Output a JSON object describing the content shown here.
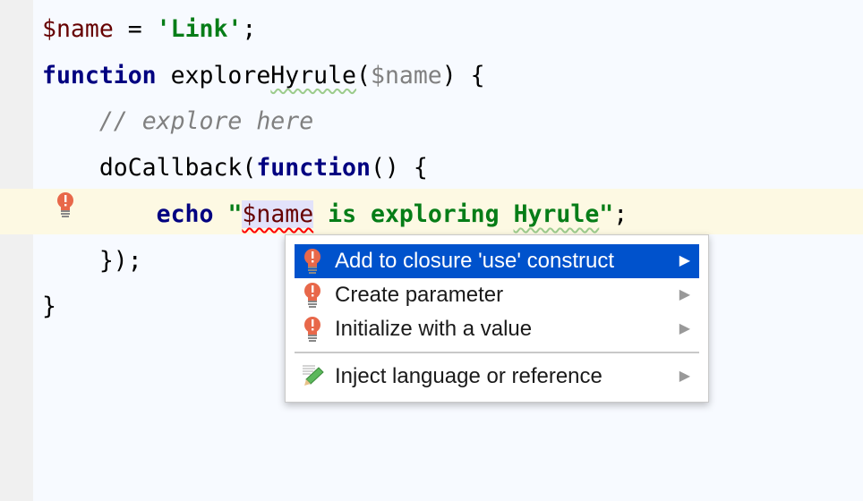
{
  "editor": {
    "lines": [
      [
        {
          "t": "$name",
          "c": "var"
        },
        {
          "t": " = ",
          "c": ""
        },
        {
          "t": "'Link'",
          "c": "str"
        },
        {
          "t": ";",
          "c": ""
        }
      ],
      [
        {
          "t": "function",
          "c": "kw"
        },
        {
          "t": " explore",
          "c": ""
        },
        {
          "t": "Hyrule",
          "c": "warn"
        },
        {
          "t": "(",
          "c": ""
        },
        {
          "t": "$name",
          "c": "param"
        },
        {
          "t": ") {",
          "c": ""
        }
      ],
      [
        {
          "t": "    ",
          "c": ""
        },
        {
          "t": "// explore here",
          "c": "cmt"
        }
      ],
      [
        {
          "t": "    doCallback(",
          "c": ""
        },
        {
          "t": "function",
          "c": "kw"
        },
        {
          "t": "() {",
          "c": ""
        }
      ],
      [
        {
          "t": "        ",
          "c": ""
        },
        {
          "t": "echo",
          "c": "kw"
        },
        {
          "t": " ",
          "c": ""
        },
        {
          "t": "\"",
          "c": "str"
        },
        {
          "t": "$name",
          "c": "var sel err"
        },
        {
          "t": " is exploring ",
          "c": "str"
        },
        {
          "t": "Hyrule",
          "c": "str warn"
        },
        {
          "t": "\"",
          "c": "str"
        },
        {
          "t": ";",
          "c": ""
        }
      ],
      [
        {
          "t": "    });",
          "c": ""
        }
      ],
      [
        {
          "t": "}",
          "c": ""
        }
      ]
    ]
  },
  "intention_menu": {
    "items": [
      {
        "label": "Add to closure 'use' construct",
        "icon": "error-bulb-icon",
        "active": true
      },
      {
        "label": "Create parameter",
        "icon": "error-bulb-icon",
        "active": false
      },
      {
        "label": "Initialize with a value",
        "icon": "error-bulb-icon",
        "active": false
      },
      {
        "label": "Inject language or reference",
        "icon": "pencil-icon",
        "active": false
      }
    ]
  },
  "colors": {
    "selection": "#0052cc",
    "keyword": "#000080",
    "string": "#067d17",
    "variable": "#660000",
    "error": "#ff0000"
  }
}
